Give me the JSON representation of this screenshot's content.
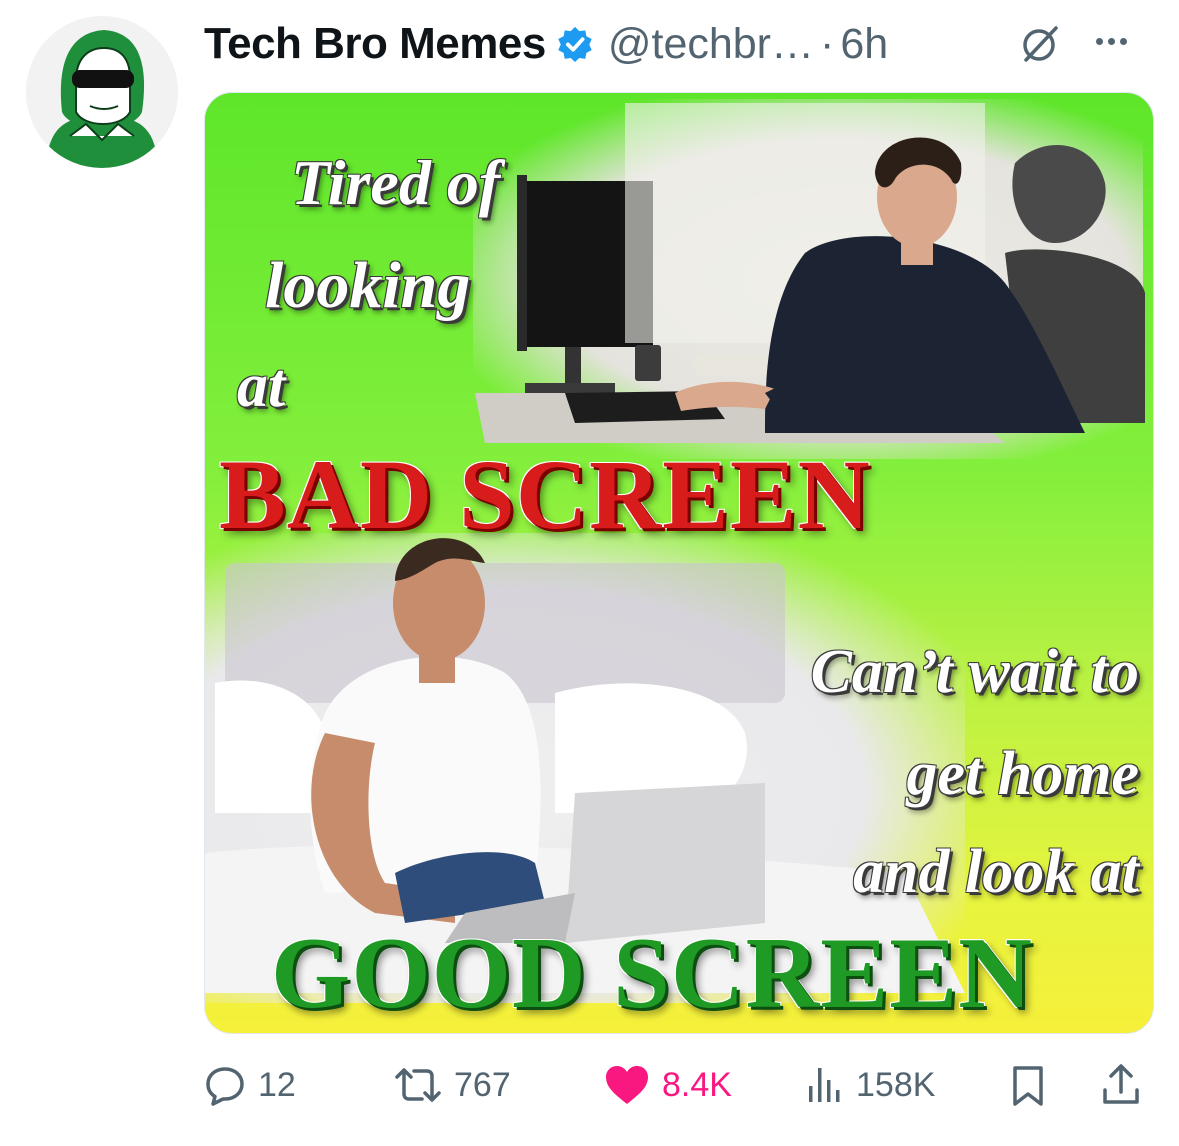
{
  "post": {
    "author_name": "Tech Bro Memes",
    "handle": "@techbr…",
    "separator": "·",
    "time": "6h",
    "verified": true,
    "avatar_icon": "green-hooded-figure-avatar",
    "grok_icon": "grok-icon",
    "more_icon": "more-options-icon"
  },
  "meme": {
    "line1": "Tired of",
    "line2": "looking",
    "line3": "at",
    "bad_screen": "BAD SCREEN",
    "line4": "Can’t wait to",
    "line5": "get home",
    "line6": "and look at",
    "good_screen": "GOOD SCREEN",
    "colors": {
      "bad": "#d81b1b",
      "good": "#1f9a25",
      "background_top": "#5ee62a",
      "background_bottom": "#f6f03a"
    }
  },
  "actions": {
    "replies": "12",
    "reposts": "767",
    "likes": "8.4K",
    "views": "158K",
    "like_color": "#f91880",
    "muted_color": "#536471"
  }
}
